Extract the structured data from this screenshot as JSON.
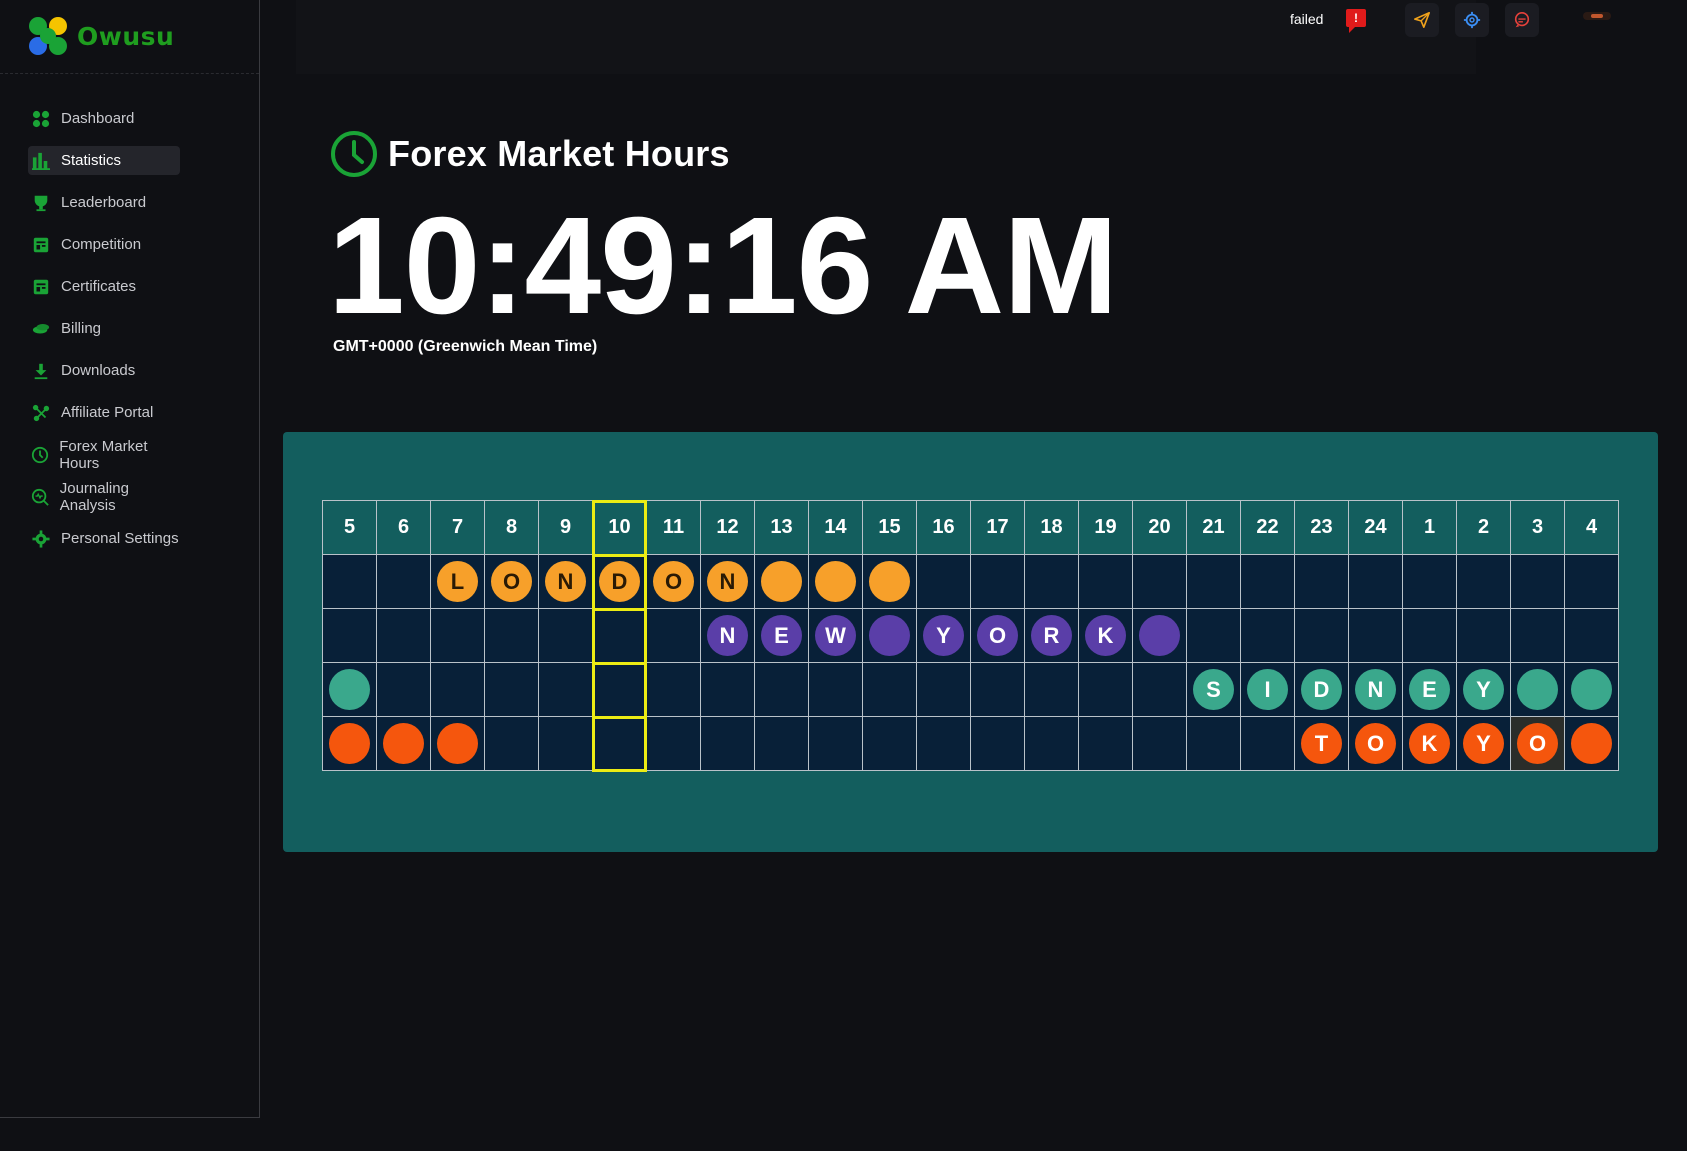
{
  "brand": {
    "name": "Owusu"
  },
  "sidebar": {
    "items": [
      {
        "label": "Dashboard",
        "icon": "dashboard-icon"
      },
      {
        "label": "Statistics",
        "icon": "bar-chart-icon",
        "active": true
      },
      {
        "label": "Leaderboard",
        "icon": "trophy-icon"
      },
      {
        "label": "Competition",
        "icon": "competition-icon"
      },
      {
        "label": "Certificates",
        "icon": "certificate-icon"
      },
      {
        "label": "Billing",
        "icon": "coins-icon"
      },
      {
        "label": "Downloads",
        "icon": "download-icon"
      },
      {
        "label": "Affiliate Portal",
        "icon": "affiliate-icon"
      },
      {
        "label": "Forex Market Hours",
        "icon": "clock-icon"
      },
      {
        "label": "Journaling Analysis",
        "icon": "analysis-icon"
      },
      {
        "label": "Personal Settings",
        "icon": "gear-icon"
      }
    ]
  },
  "topbar": {
    "status": "failed",
    "alert_mark": "!",
    "buttons": [
      "send-icon",
      "settings-icon",
      "chat-icon"
    ]
  },
  "page": {
    "title": "Forex Market Hours",
    "time": "10:49:16 AM",
    "timezone": "GMT+0000 (Greenwich Mean Time)"
  },
  "market": {
    "hours": [
      "5",
      "6",
      "7",
      "8",
      "9",
      "10",
      "11",
      "12",
      "13",
      "14",
      "15",
      "16",
      "17",
      "18",
      "19",
      "20",
      "21",
      "22",
      "23",
      "24",
      "1",
      "2",
      "3",
      "4"
    ],
    "current_hour_index": 5,
    "sessions": [
      {
        "name": "london",
        "cells": [
          "",
          "",
          "L",
          "O",
          "N",
          "D",
          "O",
          "N",
          "•",
          "•",
          "•",
          "",
          "",
          "",
          "",
          "",
          "",
          "",
          "",
          "",
          "",
          "",
          "",
          ""
        ]
      },
      {
        "name": "newyork",
        "cells": [
          "",
          "",
          "",
          "",
          "",
          "",
          "",
          "N",
          "E",
          "W",
          "•",
          "Y",
          "O",
          "R",
          "K",
          "•",
          "",
          "",
          "",
          "",
          "",
          "",
          "",
          ""
        ]
      },
      {
        "name": "sydney",
        "cells": [
          "•",
          "",
          "",
          "",
          "",
          "",
          "",
          "",
          "",
          "",
          "",
          "",
          "",
          "",
          "",
          "",
          "S",
          "I",
          "D",
          "N",
          "E",
          "Y",
          "•",
          "•"
        ]
      },
      {
        "name": "tokyo",
        "cells": [
          "•",
          "•",
          "•",
          "",
          "",
          "",
          "",
          "",
          "",
          "",
          "",
          "",
          "",
          "",
          "",
          "",
          "",
          "",
          "T",
          "O",
          "K",
          "Y",
          "O",
          "•"
        ]
      }
    ],
    "colors": {
      "london": "#f7a02a",
      "newyork": "#5a3ea8",
      "sydney": "#3aa88c",
      "tokyo": "#f5560d"
    }
  }
}
